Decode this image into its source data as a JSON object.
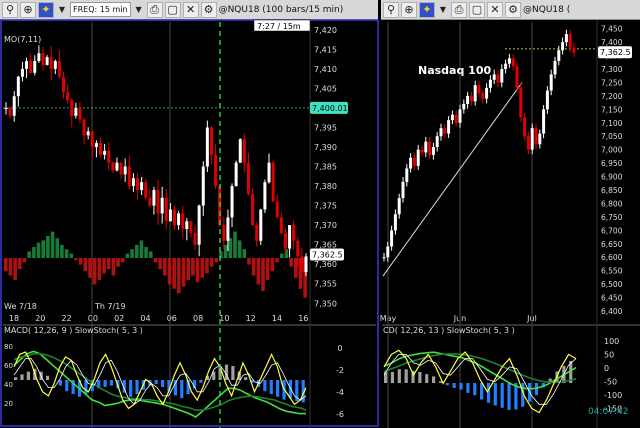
{
  "left_panel": {
    "toolbar": {
      "freq_label": "FREQ: 15 min",
      "symbol_title": "@NQU18 (100 bars/15 min)"
    },
    "time_readout": "7:27 / 15m",
    "indicator_label": "MO(7,11)",
    "last_price_tag": "7,400.01",
    "current_price_tag": "7,362.5",
    "day_labels": [
      "We 7/18",
      "Th 7/19"
    ]
  },
  "right_panel": {
    "toolbar": {
      "symbol_title": "@NQU18 ("
    },
    "annotation": "Nasdaq 100",
    "current_price_tag": "7,362.5",
    "clock": "04:07:42"
  },
  "icons": [
    "search-icon",
    "zoom-icon",
    "pin-icon",
    "dropdown-icon",
    "print-icon",
    "window-icon",
    "close-icon",
    "settings-icon"
  ],
  "colors": {
    "up_bar": "#ffffff",
    "down_bar": "#e00000",
    "hist_up": "#1a7a3a",
    "hist_down": "#b01010",
    "accent_green": "#40e060",
    "price_tag": "#40e0c0"
  },
  "chart_data": [
    {
      "type": "bar",
      "name": "intraday-price",
      "yticks": [
        7420,
        7415,
        7410,
        7405,
        7400,
        7395,
        7390,
        7385,
        7380,
        7375,
        7370,
        7365,
        7360,
        7355,
        7350
      ],
      "ytick_labels": [
        "7,420",
        "7,415",
        "7,410",
        "7,405",
        "7,400",
        "7,395",
        "7,390",
        "7,385",
        "7,380",
        "7,375",
        "7,370",
        "7,365",
        "7,360",
        "7,355",
        "7,350"
      ],
      "ylim": [
        7347,
        7422
      ],
      "xtick_labels": [
        "18",
        "20",
        "22",
        "00",
        "02",
        "04",
        "06",
        "08",
        "10",
        "12",
        "14",
        "16"
      ],
      "reference_line": 7400.01,
      "current_price": 7362.5,
      "close": [
        7400,
        7398,
        7403,
        7408,
        7410,
        7412,
        7409,
        7412,
        7414,
        7411,
        7413,
        7410,
        7412,
        7408,
        7404,
        7402,
        7398,
        7400,
        7397,
        7393,
        7394,
        7390,
        7391,
        7388,
        7389,
        7386,
        7384,
        7386,
        7383,
        7385,
        7380,
        7382,
        7379,
        7381,
        7377,
        7375,
        7379,
        7373,
        7377,
        7371,
        7374,
        7370,
        7373,
        7369,
        7371,
        7368,
        7365,
        7375,
        7385,
        7395,
        7388,
        7380,
        7370,
        7366,
        7372,
        7380,
        7386,
        7392,
        7386,
        7378,
        7370,
        7366,
        7374,
        7381,
        7386,
        7376,
        7372,
        7368,
        7364,
        7370,
        7366,
        7362,
        7358,
        7362
      ]
    },
    {
      "type": "bar",
      "name": "momentum-histogram",
      "values": [
        -6,
        -8,
        -10,
        -5,
        -2,
        3,
        5,
        7,
        8,
        10,
        12,
        9,
        6,
        4,
        2,
        -1,
        -3,
        -6,
        -9,
        -12,
        -10,
        -7,
        -5,
        -8,
        -4,
        -2,
        2,
        4,
        6,
        8,
        5,
        3,
        -2,
        -5,
        -8,
        -12,
        -14,
        -16,
        -13,
        -10,
        -8,
        -11,
        -9,
        -7,
        -4,
        -2,
        3,
        6,
        9,
        12,
        8,
        4,
        -3,
        -8,
        -12,
        -15,
        -10,
        -6,
        -2,
        2,
        4,
        -4,
        -9,
        -14,
        -18
      ]
    },
    {
      "type": "line",
      "name": "intraday-macd-stoch",
      "label": "MACD( 12,26, 9 ) SlowStoch( 5, 3 )",
      "yticks_left": [
        "80",
        "60",
        "40",
        "20"
      ],
      "yticks_right": [
        "0",
        "-2",
        "-4",
        "-6"
      ],
      "stoch_k": [
        70,
        85,
        88,
        75,
        55,
        40,
        35,
        50,
        70,
        82,
        78,
        60,
        45,
        40,
        55,
        75,
        85,
        70,
        50,
        30,
        20,
        25,
        40,
        55,
        50,
        35,
        25,
        40,
        60,
        75,
        60,
        40,
        30,
        45,
        65,
        80,
        70,
        50,
        35,
        55,
        75,
        60,
        40,
        55,
        70,
        85,
        70,
        45,
        35,
        25,
        30,
        45
      ],
      "stoch_d": [
        60,
        70,
        80,
        80,
        70,
        55,
        45,
        45,
        55,
        70,
        78,
        72,
        60,
        50,
        48,
        60,
        75,
        78,
        65,
        48,
        32,
        25,
        30,
        42,
        50,
        45,
        35,
        35,
        48,
        60,
        62,
        52,
        40,
        40,
        52,
        68,
        72,
        62,
        48,
        48,
        60,
        62,
        52,
        50,
        60,
        72,
        75,
        62,
        48,
        35,
        30,
        35
      ],
      "macd": [
        -1.0,
        -0.5,
        0.0,
        0.2,
        0.0,
        -0.5,
        -1.0,
        -1.5,
        -2.0,
        -2.5,
        -3.0,
        -3.5,
        -4.0,
        -4.2,
        -4.5,
        -4.4,
        -4.3,
        -4.1,
        -4.0,
        -4.0,
        -4.1,
        -4.2,
        -4.3,
        -4.4,
        -4.6,
        -4.8,
        -5.0,
        -5.2,
        -5.5,
        -5.0,
        -4.5,
        -4.0,
        -3.5,
        -3.0,
        -3.0,
        -3.2,
        -3.5,
        -3.8,
        -4.0,
        -4.2,
        -4.5,
        -4.8,
        -5.0,
        -5.1,
        -5.2,
        -5.2
      ],
      "signal": [
        -0.5,
        -0.3,
        -0.2,
        0.0,
        0.0,
        -0.1,
        -0.3,
        -0.6,
        -0.9,
        -1.3,
        -1.7,
        -2.1,
        -2.5,
        -2.9,
        -3.2,
        -3.5,
        -3.7,
        -3.8,
        -3.9,
        -3.9,
        -4.0,
        -4.0,
        -4.1,
        -4.2,
        -4.3,
        -4.4,
        -4.6,
        -4.7,
        -4.9,
        -4.9,
        -4.8,
        -4.6,
        -4.4,
        -4.1,
        -3.9,
        -3.8,
        -3.7,
        -3.7,
        -3.8,
        -3.9,
        -4.0,
        -4.2,
        -4.4,
        -4.6,
        -4.7,
        -4.9
      ],
      "histogram": [
        0.2,
        0.4,
        0.6,
        0.8,
        0.6,
        0.3,
        0.0,
        -0.4,
        -0.8,
        -1.0,
        -1.2,
        -1.0,
        -0.8,
        -0.6,
        -0.5,
        -0.4,
        -0.6,
        -0.9,
        -1.2,
        -1.0,
        -0.7,
        -0.4,
        -0.3,
        -0.5,
        -0.8,
        -1.1,
        -1.3,
        -1.0,
        -0.6,
        -0.2,
        0.3,
        0.6,
        0.9,
        1.1,
        1.0,
        0.6,
        0.2,
        -0.2,
        -0.5,
        -0.8,
        -1.0,
        -1.2,
        -1.4,
        -1.3,
        -1.5,
        -1.6
      ]
    },
    {
      "type": "bar",
      "name": "daily-price",
      "yticks": [
        7450,
        7400,
        7350,
        7300,
        7250,
        7200,
        7150,
        7100,
        7050,
        7000,
        6950,
        6900,
        6850,
        6800,
        6750,
        6700,
        6650,
        6600,
        6550,
        6500,
        6450,
        6400
      ],
      "ytick_labels": [
        "7,450",
        "7,400",
        "7,350",
        "7,300",
        "7,250",
        "7,200",
        "7,150",
        "7,100",
        "7,050",
        "7,000",
        "6,950",
        "6,900",
        "6,850",
        "6,800",
        "6,750",
        "6,700",
        "6,650",
        "6,600",
        "6,550",
        "6,500",
        "6,450",
        "6,400"
      ],
      "ylim": [
        6385,
        7475
      ],
      "xtick_labels": [
        "May",
        "Jun",
        "Jul"
      ],
      "trendline": [
        6530,
        7250
      ],
      "reference_line": 7375,
      "current_price": 7362.5,
      "close": [
        6600,
        6640,
        6700,
        6760,
        6820,
        6880,
        6930,
        6970,
        6940,
        7000,
        6990,
        7030,
        6980,
        7010,
        7050,
        7080,
        7060,
        7110,
        7130,
        7100,
        7150,
        7170,
        7200,
        7180,
        7240,
        7210,
        7190,
        7230,
        7260,
        7280,
        7250,
        7300,
        7320,
        7340,
        7310,
        7230,
        7120,
        7050,
        7000,
        7080,
        7020,
        7060,
        7150,
        7220,
        7280,
        7330,
        7370,
        7400,
        7430,
        7380,
        7362
      ]
    },
    {
      "type": "line",
      "name": "daily-macd-stoch",
      "label": "CD( 12,26, 13 ) SlowStoch( 5, 3 )",
      "yticks": [
        "100",
        "50",
        "0",
        "-50",
        "-100",
        "-150"
      ],
      "stoch_k": [
        70,
        85,
        90,
        80,
        60,
        75,
        85,
        70,
        50,
        65,
        80,
        88,
        75,
        55,
        40,
        55,
        70,
        80,
        60,
        35,
        20,
        15,
        30,
        50,
        70,
        85,
        80
      ],
      "stoch_d": [
        60,
        75,
        85,
        85,
        75,
        72,
        78,
        75,
        62,
        60,
        70,
        80,
        80,
        68,
        55,
        52,
        60,
        70,
        68,
        52,
        35,
        25,
        25,
        38,
        55,
        72,
        80
      ],
      "macd": [
        60,
        70,
        85,
        95,
        100,
        105,
        108,
        110,
        105,
        100,
        95,
        90,
        80,
        70,
        55,
        40,
        25,
        10,
        -5,
        -15,
        -20,
        -20,
        -15,
        -5,
        10,
        25,
        40,
        55
      ],
      "signal": [
        40,
        50,
        60,
        70,
        78,
        85,
        92,
        98,
        102,
        104,
        104,
        102,
        98,
        92,
        85,
        76,
        66,
        55,
        44,
        33,
        23,
        14,
        7,
        3,
        2,
        4,
        9,
        15
      ],
      "histogram": [
        20,
        20,
        25,
        25,
        22,
        20,
        16,
        12,
        3,
        -4,
        -9,
        -12,
        -18,
        -22,
        -30,
        -36,
        -41,
        -45,
        -49,
        -48,
        -43,
        -34,
        -22,
        -8,
        8,
        21,
        31,
        40
      ]
    }
  ]
}
